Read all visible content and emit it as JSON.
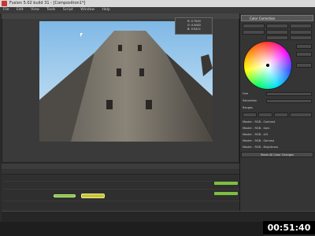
{
  "window": {
    "title": "Fusion 5.02 build 31 - [Composition1*]"
  },
  "menubar": {
    "items": [
      "File",
      "Edit",
      "View",
      "Tools",
      "Script",
      "Window",
      "Help"
    ]
  },
  "viewer": {
    "info": {
      "line1": "R: 0.7540",
      "line2": "G: 0.8432",
      "line3": "B: 0.9411"
    }
  },
  "panel": {
    "header": "Color Correction",
    "labels": [
      "Hue",
      "Saturation",
      "Ranges",
      "Master - RGB - Contrast",
      "Master - RGB - Gain",
      "Master - RGB - Lift",
      "Master - RGB - Gamma",
      "Master - RGB - Brightness"
    ],
    "reset_label": "Reset All Color Changes"
  },
  "timecode": "00:51:40",
  "colors": {
    "accent_green": "#7fbf3f",
    "accent_yellow": "#c7c23a"
  }
}
